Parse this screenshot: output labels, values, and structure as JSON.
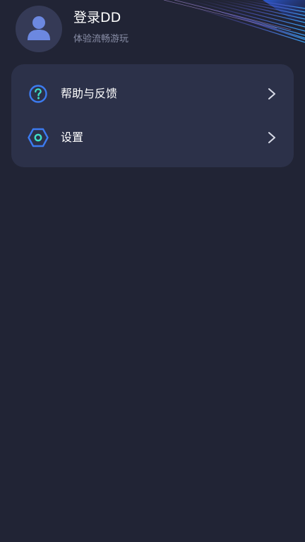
{
  "profile": {
    "title": "登录DD",
    "subtitle": "体验流畅游玩",
    "avatar_icon": "user-icon"
  },
  "menu": {
    "items": [
      {
        "label": "帮助与反馈",
        "icon": "help-icon"
      },
      {
        "label": "设置",
        "icon": "settings-icon"
      }
    ]
  },
  "colors": {
    "background": "#212435",
    "card": "#2c3149",
    "accent_blue": "#3c7bf0",
    "accent_teal": "#3ee0c6"
  }
}
